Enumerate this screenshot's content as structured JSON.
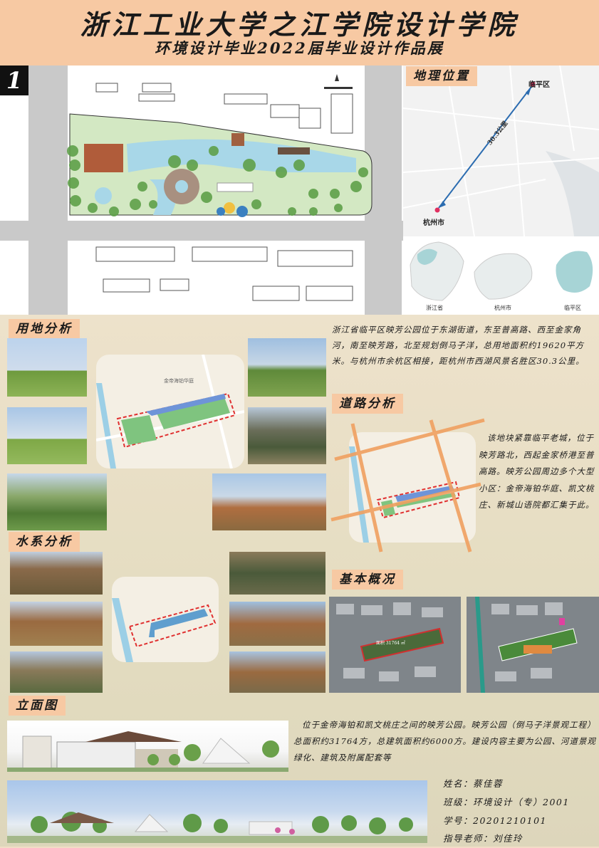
{
  "header": {
    "title": "浙江工业大学之江学院设计学院",
    "subtitle": "环境设计毕业2022届毕业设计作品展"
  },
  "badge": "1",
  "location": {
    "label": "地理位置",
    "distance": "30.3公里",
    "place_north": "临平区",
    "place_city": "杭州市",
    "map_captions": [
      "浙江省",
      "杭州市",
      "临平区"
    ]
  },
  "land": {
    "label": "用地分析",
    "text": "浙江省临平区映芳公园位于东湖街道，东至普高路、西至金家角河，南至映芳路，北至规划倒马子洋，总用地面积约19620平方米。与杭州市余杭区相接，距杭州市西湖风景名胜区30.3公里。",
    "map_label": "金帝海铂华庭"
  },
  "road": {
    "label": "道路分析",
    "text": "该地块紧靠临平老城，位于映芳路北，西起金家桥港至普高路。映芳公园周边多个大型小区：金帝海铂华庭、凯文桃庄、新城山语院都汇集于此。"
  },
  "water": {
    "label": "水系分析"
  },
  "basic": {
    "label": "基本概况",
    "area_tag": "面积 31764 ㎡"
  },
  "elevation": {
    "label": "立面图",
    "text": "位于金帝海铂和凯文桃庄之间的映芳公园。映芳公园（倒马子洋景观工程）总面积约31764方，总建筑面积约6000方。建设内容主要为公园、河道景观绿化、建筑及附属配套等"
  },
  "info": {
    "name": "姓名：蔡佳蓉",
    "class": "班级：环境设计（专）2001",
    "student_id": "学号：20201210101",
    "teacher": "指导老师：刘佳玲"
  },
  "colors": {
    "accent": "#f7c9a3",
    "road": "#f0a060",
    "boundary": "#e03030",
    "green": "#7fc47f",
    "water": "#9ccfe6"
  }
}
